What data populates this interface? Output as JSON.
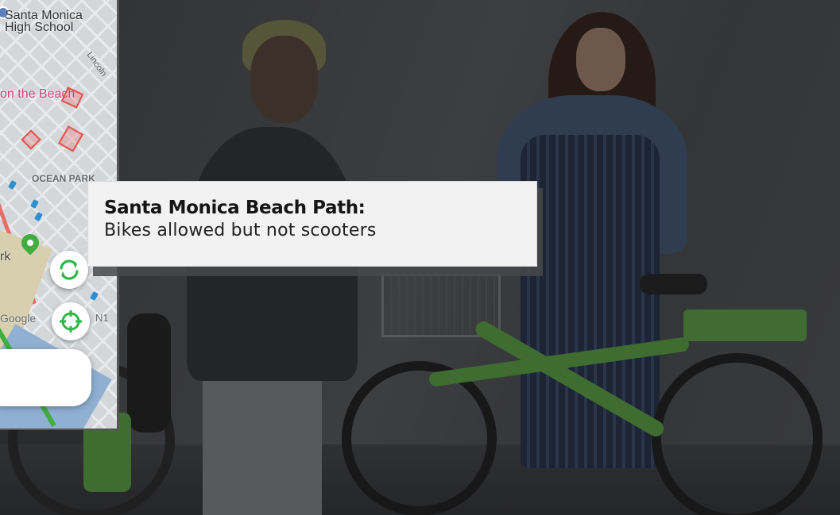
{
  "map": {
    "school_label_line1": "Santa Monica",
    "school_label_line2": "High School",
    "beach_label": "on the Beach",
    "street_label": "Lincoln",
    "neighborhood_label": "OCEAN PARK",
    "park_label": "rk",
    "attribution": "Google",
    "road_label": "N1"
  },
  "controls": {
    "refresh_icon": "refresh-icon",
    "locate_icon": "crosshair-icon",
    "accent_color": "#2db84a"
  },
  "callout": {
    "title": "Santa Monica Beach Path:",
    "body": "Bikes allowed but not scooters"
  }
}
